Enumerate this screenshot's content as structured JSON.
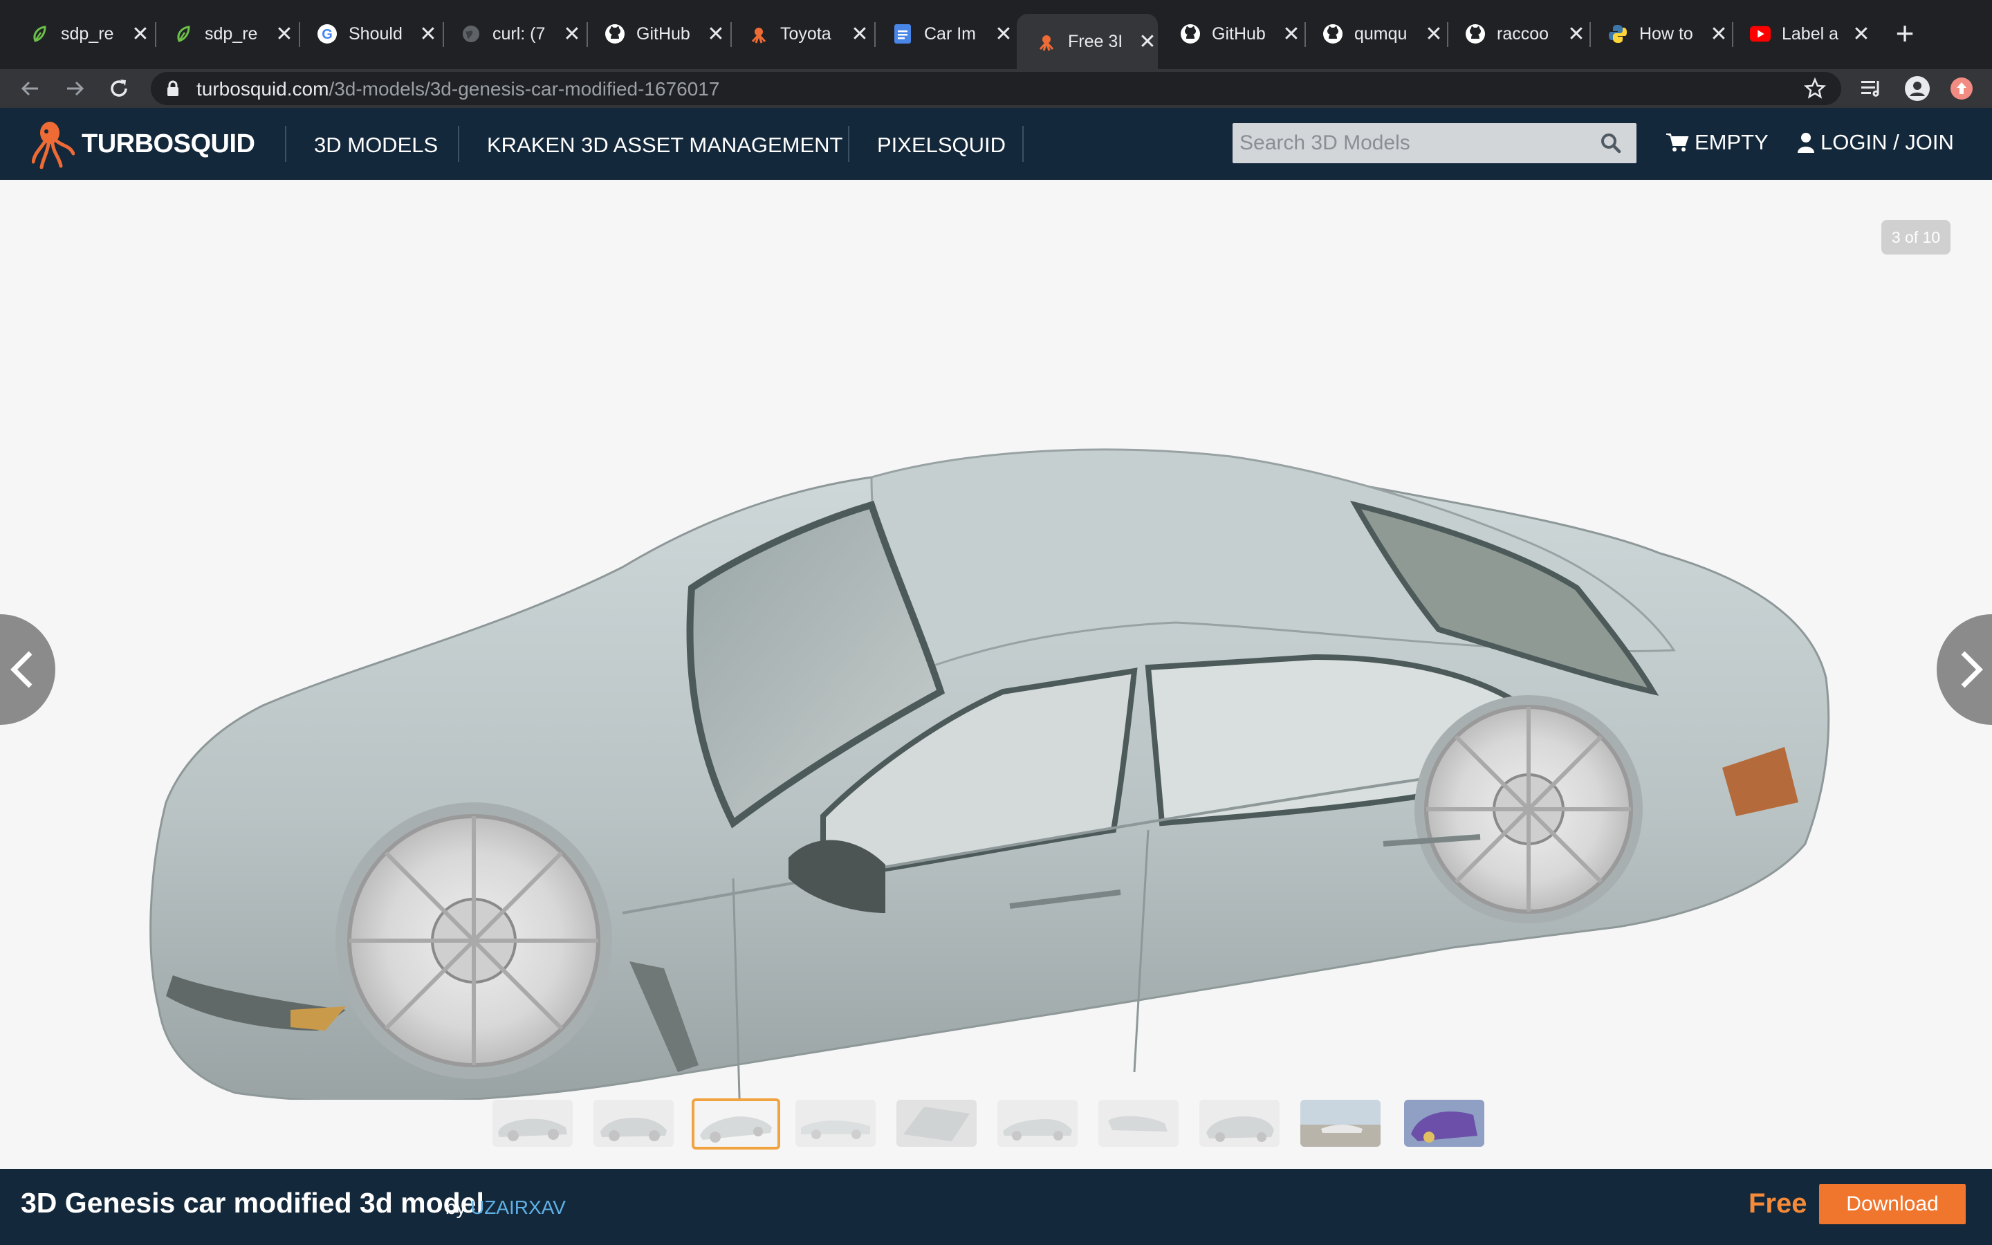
{
  "browser": {
    "tabs": [
      {
        "title": "sdp_re",
        "icon": "leaf-icon"
      },
      {
        "title": "sdp_re",
        "icon": "leaf-icon"
      },
      {
        "title": "Should",
        "icon": "google-icon"
      },
      {
        "title": "curl: (7",
        "icon": "globe-icon"
      },
      {
        "title": "GitHub",
        "icon": "github-icon"
      },
      {
        "title": "Toyota",
        "icon": "turbosquid-icon"
      },
      {
        "title": "Car Im",
        "icon": "docs-icon"
      },
      {
        "title": "Free 3I",
        "icon": "turbosquid-icon",
        "active": true
      },
      {
        "title": "GitHub",
        "icon": "github-icon"
      },
      {
        "title": "qumqu",
        "icon": "github-icon"
      },
      {
        "title": "raccoo",
        "icon": "github-icon"
      },
      {
        "title": "How to",
        "icon": "python-icon"
      },
      {
        "title": "Label a",
        "icon": "youtube-icon"
      }
    ],
    "new_tab_label": "+",
    "url_host": "turbosquid.com",
    "url_path": "/3d-models/3d-genesis-car-modified-1676017"
  },
  "site": {
    "logo_text": "TURBOSQUID",
    "nav": [
      "3D MODELS",
      "KRAKEN 3D ASSET MANAGEMENT",
      "PIXELSQUID"
    ],
    "search_placeholder": "Search 3D Models",
    "cart_label": "EMPTY",
    "login_label": "LOGIN / JOIN"
  },
  "viewer": {
    "counter": "3 of 10",
    "thumbnail_count": 10,
    "selected_thumbnail": 3
  },
  "product": {
    "title": "3D Genesis car modified 3d model",
    "by": "by",
    "author": "UZAIRXAV",
    "price": "Free",
    "download_label": "Download"
  },
  "colors": {
    "site_header": "#14283b",
    "accent_orange": "#f0752d",
    "author_link": "#5fb1e6",
    "selected_thumb_border": "#f0a33f"
  }
}
